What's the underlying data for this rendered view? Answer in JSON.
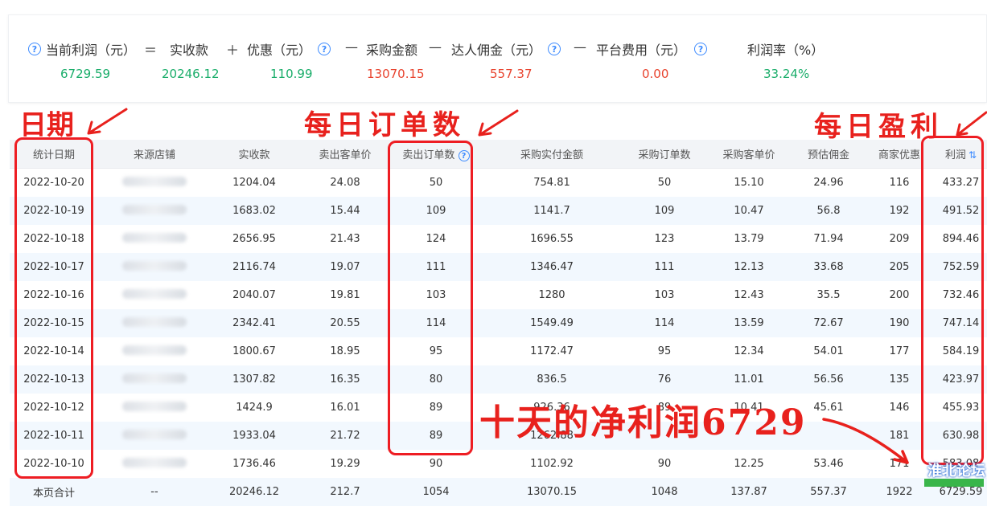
{
  "summary": {
    "formula": [
      {
        "label": "当前利润（元）",
        "help": true,
        "value": "6729.59",
        "color": "green"
      },
      {
        "op": "＝"
      },
      {
        "label": "实收款",
        "value": "20246.12",
        "color": "green"
      },
      {
        "op": "＋"
      },
      {
        "label": "优惠（元）",
        "help": true,
        "value": "110.99",
        "color": "green"
      },
      {
        "op": "—"
      },
      {
        "label": "采购金额",
        "value": "13070.15",
        "color": "red"
      },
      {
        "op": "—"
      },
      {
        "label": "达人佣金（元）",
        "help": true,
        "value": "557.37",
        "color": "red"
      },
      {
        "op": "—"
      },
      {
        "label": "平台费用（元）",
        "help": true,
        "value": "0.00",
        "color": "red"
      },
      {
        "label": "利润率（%）",
        "value": "33.24%",
        "color": "green"
      }
    ]
  },
  "annotations": {
    "date": "日期",
    "orders": "每日订单数",
    "profit": "每日盈利",
    "net": "十天的净利润6729"
  },
  "table": {
    "headers": [
      "统计日期",
      "来源店铺",
      "实收款",
      "卖出客单价",
      "卖出订单数",
      "采购实付金额",
      "采购订单数",
      "采购客单价",
      "预估佣金",
      "商家优惠",
      "利润"
    ],
    "rows": [
      [
        "2022-10-20",
        "",
        "1204.04",
        "24.08",
        "50",
        "754.81",
        "50",
        "15.10",
        "24.96",
        "116",
        "433.27"
      ],
      [
        "2022-10-19",
        "",
        "1683.02",
        "15.44",
        "109",
        "1141.7",
        "109",
        "10.47",
        "56.8",
        "192",
        "491.52"
      ],
      [
        "2022-10-18",
        "",
        "2656.95",
        "21.43",
        "124",
        "1696.55",
        "123",
        "13.79",
        "71.94",
        "209",
        "894.46"
      ],
      [
        "2022-10-17",
        "",
        "2116.74",
        "19.07",
        "111",
        "1346.47",
        "111",
        "12.13",
        "33.68",
        "205",
        "752.59"
      ],
      [
        "2022-10-16",
        "",
        "2040.07",
        "19.81",
        "103",
        "1280",
        "103",
        "12.43",
        "35.5",
        "200",
        "732.46"
      ],
      [
        "2022-10-15",
        "",
        "2342.41",
        "20.55",
        "114",
        "1549.49",
        "114",
        "13.59",
        "72.67",
        "190",
        "747.14"
      ],
      [
        "2022-10-14",
        "",
        "1800.67",
        "18.95",
        "95",
        "1172.47",
        "95",
        "12.34",
        "54.01",
        "177",
        "584.19"
      ],
      [
        "2022-10-13",
        "",
        "1307.82",
        "16.35",
        "80",
        "836.5",
        "76",
        "11.01",
        "56.56",
        "135",
        "423.97"
      ],
      [
        "2022-10-12",
        "",
        "1424.9",
        "16.01",
        "89",
        "926.36",
        "89",
        "10.41",
        "45.61",
        "146",
        "455.93"
      ],
      [
        "2022-10-11",
        "",
        "1933.04",
        "21.72",
        "89",
        "1262.88",
        "",
        "",
        "",
        "181",
        "630.98"
      ],
      [
        "2022-10-10",
        "",
        "1736.46",
        "19.29",
        "90",
        "1102.92",
        "90",
        "12.25",
        "53.46",
        "171",
        "583.08"
      ]
    ],
    "total": [
      "本页合计",
      "--",
      "20246.12",
      "212.7",
      "1054",
      "13070.15",
      "1048",
      "137.87",
      "557.37",
      "1922",
      "6729.59"
    ]
  },
  "watermark": "淮北论坛"
}
